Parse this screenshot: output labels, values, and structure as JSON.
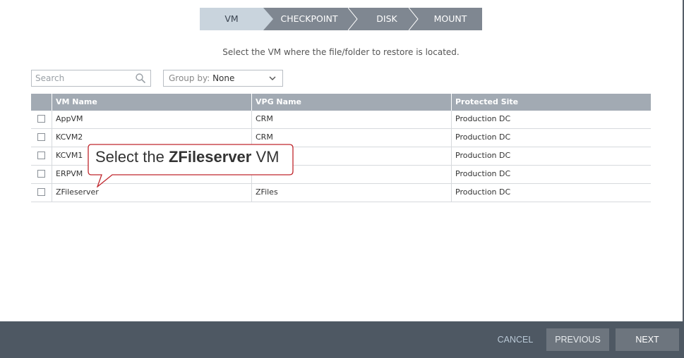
{
  "wizard": {
    "steps": [
      {
        "label": "VM",
        "state": "active"
      },
      {
        "label": "CHECKPOINT",
        "state": "pending"
      },
      {
        "label": "DISK",
        "state": "pending"
      },
      {
        "label": "MOUNT",
        "state": "pending"
      }
    ]
  },
  "instruction": "Select the VM where the file/folder to restore is located.",
  "search": {
    "placeholder": "Search",
    "value": ""
  },
  "group_by": {
    "label": "Group by:",
    "value": "None"
  },
  "table": {
    "columns": [
      "VM Name",
      "VPG Name",
      "Protected Site"
    ],
    "rows": [
      {
        "vm": "AppVM",
        "vpg": "CRM",
        "site": "Production DC",
        "checked": false
      },
      {
        "vm": "KCVM2",
        "vpg": "CRM",
        "site": "Production DC",
        "checked": false
      },
      {
        "vm": "KCVM1",
        "vpg": "",
        "site": "Production DC",
        "checked": false
      },
      {
        "vm": "ERPVM",
        "vpg": "",
        "site": "Production DC",
        "checked": false
      },
      {
        "vm": "ZFileserver",
        "vpg": "ZFiles",
        "site": "Production DC",
        "checked": false
      }
    ]
  },
  "callout": {
    "prefix": "Select the ",
    "emphasis": "ZFileserver",
    "suffix": " VM"
  },
  "footer": {
    "cancel": "CANCEL",
    "previous": "PREVIOUS",
    "next": "NEXT"
  },
  "colors": {
    "active_step": "#c9d4dd",
    "inactive_step": "#7f8791",
    "table_header": "#a2aab3",
    "footer_bg": "#4e5863",
    "button_bg": "#6d757e",
    "callout_border": "#c0272d"
  }
}
